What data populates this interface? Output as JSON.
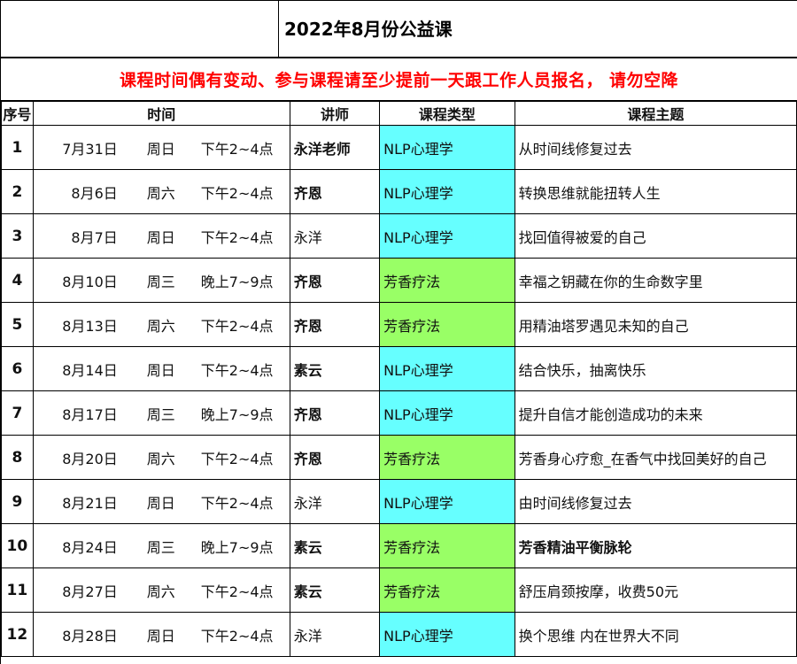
{
  "title": "2022年8月份公益课",
  "notice": "课程时间偶有变动、参与课程请至少提前一天跟工作人员报名， 请勿空降",
  "headers": {
    "seq": "序号",
    "time": "时间",
    "teacher": "讲师",
    "type": "课程类型",
    "topic": "课程主题"
  },
  "colors": {
    "nlp": "#66ffff",
    "aroma": "#99ff66",
    "notice": "#ff0000"
  },
  "rows": [
    {
      "seq": "1",
      "date": "7月31日",
      "day": "周日",
      "slot": "下午2~4点",
      "teacher": "永洋老师",
      "teacher_bold": true,
      "type": "NLP心理学",
      "kind": "nlp",
      "topic": "从时间线修复过去",
      "topic_bold": false
    },
    {
      "seq": "2",
      "date": "8月6日",
      "day": "周六",
      "slot": "下午2~4点",
      "teacher": "齐恩",
      "teacher_bold": true,
      "type": "NLP心理学",
      "kind": "nlp",
      "topic": "转换思维就能扭转人生",
      "topic_bold": false
    },
    {
      "seq": "3",
      "date": "8月7日",
      "day": "周日",
      "slot": "下午2~4点",
      "teacher": "永洋",
      "teacher_bold": false,
      "type": "NLP心理学",
      "kind": "nlp",
      "topic": "找回值得被爱的自己",
      "topic_bold": false
    },
    {
      "seq": "4",
      "date": "8月10日",
      "day": "周三",
      "slot": "晚上7~9点",
      "teacher": "齐恩",
      "teacher_bold": true,
      "type": "芳香疗法",
      "kind": "aroma",
      "topic": "幸福之钥藏在你的生命数字里",
      "topic_bold": false
    },
    {
      "seq": "5",
      "date": "8月13日",
      "day": "周六",
      "slot": "下午2~4点",
      "teacher": "齐恩",
      "teacher_bold": true,
      "type": "芳香疗法",
      "kind": "aroma",
      "topic": "用精油塔罗遇见未知的自己",
      "topic_bold": false
    },
    {
      "seq": "6",
      "date": "8月14日",
      "day": "周日",
      "slot": "下午2~4点",
      "teacher": "素云",
      "teacher_bold": true,
      "type": "NLP心理学",
      "kind": "nlp",
      "topic": "结合快乐，抽离快乐",
      "topic_bold": false
    },
    {
      "seq": "7",
      "date": "8月17日",
      "day": "周三",
      "slot": "晚上7~9点",
      "teacher": "齐恩",
      "teacher_bold": true,
      "type": "NLP心理学",
      "kind": "nlp",
      "topic": "提升自信才能创造成功的未来",
      "topic_bold": false
    },
    {
      "seq": "8",
      "date": "8月20日",
      "day": "周六",
      "slot": "下午2~4点",
      "teacher": "齐恩",
      "teacher_bold": true,
      "type": "芳香疗法",
      "kind": "aroma",
      "topic": "芳香身心疗愈_在香气中找回美好的自己",
      "topic_bold": false
    },
    {
      "seq": "9",
      "date": "8月21日",
      "day": "周日",
      "slot": "下午2~4点",
      "teacher": "永洋",
      "teacher_bold": false,
      "type": "NLP心理学",
      "kind": "nlp",
      "topic": "由时间线修复过去",
      "topic_bold": false
    },
    {
      "seq": "10",
      "date": "8月24日",
      "day": "周三",
      "slot": "晚上7~9点",
      "teacher": "素云",
      "teacher_bold": true,
      "type": "芳香疗法",
      "kind": "aroma",
      "topic": "芳香精油平衡脉轮",
      "topic_bold": true
    },
    {
      "seq": "11",
      "date": "8月27日",
      "day": "周六",
      "slot": "下午2~4点",
      "teacher": "素云",
      "teacher_bold": true,
      "type": "芳香疗法",
      "kind": "aroma",
      "topic": "舒压肩颈按摩，收费50元",
      "topic_bold": false
    },
    {
      "seq": "12",
      "date": "8月28日",
      "day": "周日",
      "slot": "下午2~4点",
      "teacher": "永洋",
      "teacher_bold": false,
      "type": "NLP心理学",
      "kind": "nlp",
      "topic": "换个思维 内在世界大不同",
      "topic_bold": false
    }
  ]
}
